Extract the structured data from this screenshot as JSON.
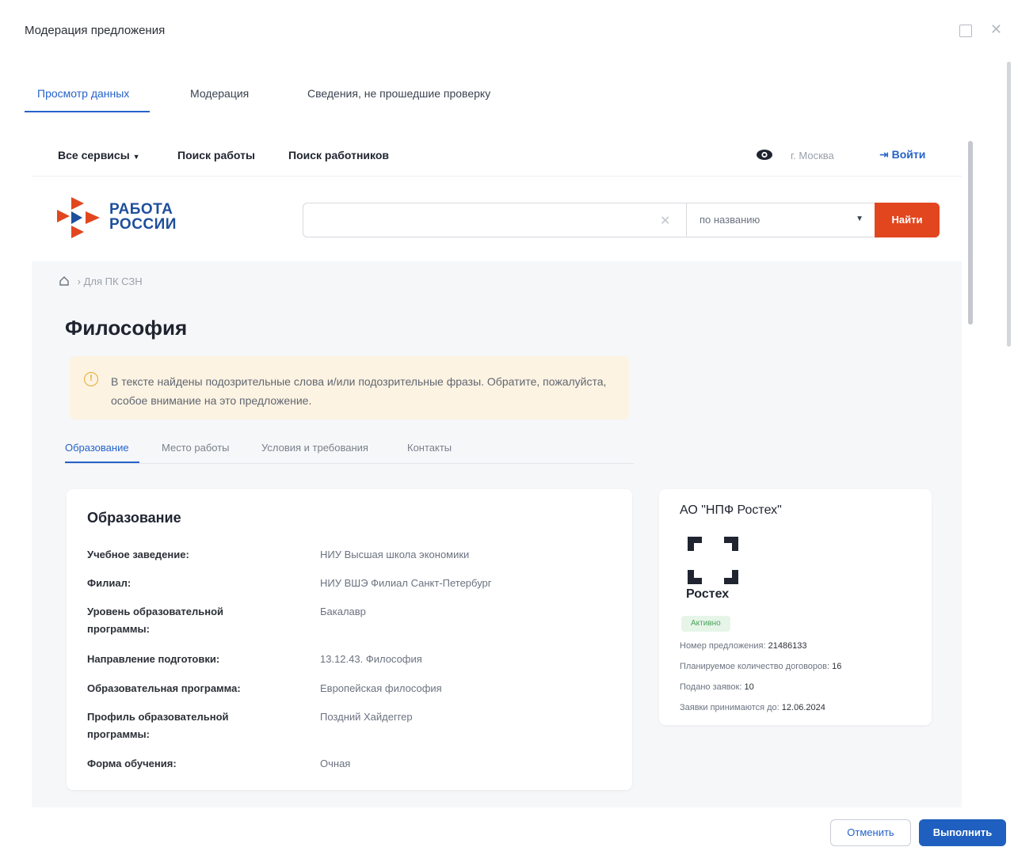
{
  "modal": {
    "title": "Модерация предложения"
  },
  "mod_tabs": [
    {
      "label": "Просмотр данных",
      "active": true
    },
    {
      "label": "Модерация",
      "active": false
    },
    {
      "label": "Сведения, не прошедшие проверку",
      "active": false
    }
  ],
  "site_top": {
    "all_services": "Все сервисы",
    "job_search": "Поиск работы",
    "worker_search": "Поиск работников",
    "city": "г. Москва",
    "login": "Войти"
  },
  "site_header": {
    "logo_line1": "РАБОТА",
    "logo_line2": "РОССИИ",
    "search_value": "",
    "search_mode": "по названию",
    "find_label": "Найти"
  },
  "breadcrumb": {
    "current": "Для ПК СЗН"
  },
  "page_title": "Философия",
  "warning": {
    "text": "В тексте найдены подозрительные слова и/или подозрительные фразы. Обратите, пожалуйста, особое внимание на это предложение."
  },
  "content_tabs": [
    {
      "label": "Образование",
      "active": true
    },
    {
      "label": "Место работы",
      "active": false
    },
    {
      "label": "Условия и требования",
      "active": false
    },
    {
      "label": "Контакты",
      "active": false
    }
  ],
  "education": {
    "title": "Образование",
    "rows": [
      {
        "label": "Учебное заведение:",
        "value": "НИУ Высшая школа экономики"
      },
      {
        "label": "Филиал:",
        "value": "НИУ ВШЭ Филиал Санкт-Петербург"
      },
      {
        "label": "Уровень образовательной программы:",
        "value": "Бакалавр"
      },
      {
        "label": "Направление подготовки:",
        "value": "13.12.43. Философия"
      },
      {
        "label": "Образовательная программа:",
        "value": "Европейская философия"
      },
      {
        "label": "Профиль образовательной программы:",
        "value": "Поздний Хайдеггер"
      },
      {
        "label": "Форма обучения:",
        "value": "Очная"
      }
    ]
  },
  "employer": {
    "name": "АО \"НПФ Ростех\"",
    "logo_text": "Ростех",
    "badge": "Активно",
    "offer_number_label": "Номер предложения:",
    "offer_number": "21486133",
    "planned_contracts_label": "Планируемое количество договоров:",
    "planned_contracts": "16",
    "applications_label": "Подано заявок:",
    "applications": "10",
    "deadline_label": "Заявки принимаются до:",
    "deadline": "12.06.2024"
  },
  "footer": {
    "cancel_label": "Отменить",
    "run_label": "Выполнить"
  },
  "colors": {
    "accent": "#2563c9",
    "brand_orange": "#e2461f",
    "warning_bg": "#fdf3e2",
    "primary_button": "#1f5fbf"
  }
}
